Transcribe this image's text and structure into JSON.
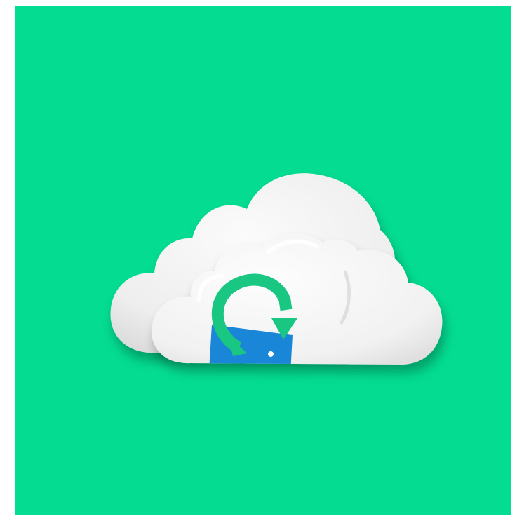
{
  "illustration": {
    "subject": "cloud-sync-icon",
    "icons": [
      "cloud-icon",
      "refresh-arrow-icon",
      "hard-drive-icon"
    ]
  },
  "colors": {
    "page_background": "#ffffff",
    "panel_background": "#03dc91",
    "cloud_light": "#f7f7f7",
    "cloud_shade": "#dcdcdc",
    "arrow": "#19c783",
    "drive": "#1a86d8"
  }
}
